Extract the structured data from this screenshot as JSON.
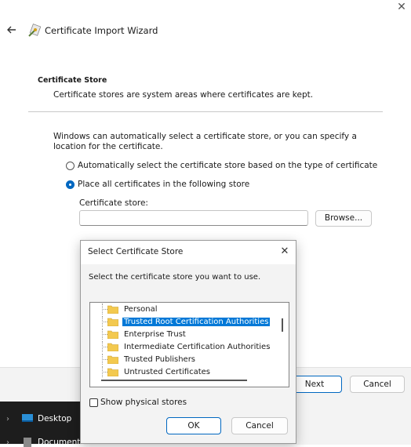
{
  "wizard": {
    "title": "Certificate Import Wizard",
    "back_icon": "back-arrow-icon",
    "title_icon": "certificate-wizard-icon",
    "section_title": "Certificate Store",
    "section_desc": "Certificate stores are system areas where certificates are kept.",
    "intro": "Windows can automatically select a certificate store, or you can specify a location for the certificate.",
    "radio_auto": "Automatically select the certificate store based on the type of certificate",
    "radio_manual": "Place all certificates in the following store",
    "selected_option": "manual",
    "store_label": "Certificate store:",
    "store_value": "",
    "browse_label": "Browse...",
    "next_label": "Next",
    "cancel_label": "Cancel",
    "accent_color": "#0067c0"
  },
  "taskbar": {
    "items": [
      {
        "label": "Desktop",
        "icon": "desktop-icon"
      },
      {
        "label": "Documents",
        "icon": "documents-icon"
      }
    ]
  },
  "dialog": {
    "title": "Select Certificate Store",
    "prompt": "Select the certificate store you want to use.",
    "stores": [
      {
        "label": "Personal",
        "selected": false
      },
      {
        "label": "Trusted Root Certification Authorities",
        "selected": true
      },
      {
        "label": "Enterprise Trust",
        "selected": false
      },
      {
        "label": "Intermediate Certification Authorities",
        "selected": false
      },
      {
        "label": "Trusted Publishers",
        "selected": false
      },
      {
        "label": "Untrusted Certificates",
        "selected": false
      }
    ],
    "show_physical_label": "Show physical stores",
    "show_physical_checked": false,
    "ok_label": "OK",
    "cancel_label": "Cancel",
    "selection_color": "#0078d7"
  }
}
